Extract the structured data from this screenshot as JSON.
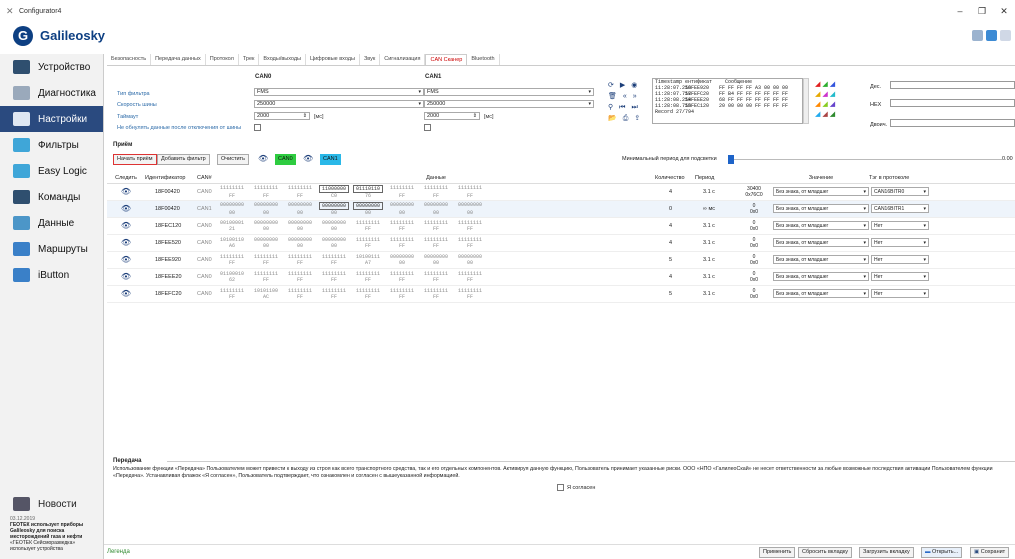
{
  "window": {
    "title": "Configurator4",
    "minimize": "–",
    "maximize": "❐",
    "close": "✕"
  },
  "brand": {
    "logo_letter": "G",
    "logo_text": "Galileosky"
  },
  "sidebar": {
    "items": [
      {
        "label": "Устройство",
        "icon": "device-icon",
        "color": "#2f4f6f"
      },
      {
        "label": "Диагностика",
        "icon": "diagnostics-icon",
        "color": "#9aa9bb"
      },
      {
        "label": "Настройки",
        "icon": "gear-icon",
        "color": "#dfe7f2"
      },
      {
        "label": "Фильтры",
        "icon": "filter-icon",
        "color": "#3fa6d8"
      },
      {
        "label": "Easy Logic",
        "icon": "puzzle-icon",
        "color": "#3fa6d8"
      },
      {
        "label": "Команды",
        "icon": "commands-icon",
        "color": "#2f4f6f"
      },
      {
        "label": "Данные",
        "icon": "data-icon",
        "color": "#4c96c8"
      },
      {
        "label": "Маршруты",
        "icon": "route-icon",
        "color": "#3a80c8"
      },
      {
        "label": "iButton",
        "icon": "ibutton-icon",
        "color": "#3a80c8"
      }
    ],
    "active_index": 2,
    "news_label": "Новости",
    "news_date": "03.12.2019",
    "news_title": "ГЕОТЕК использует приборы Galileosky для поиска месторождений газа и нефти",
    "news_text": "«ГЕОТЕК Сейсморазведка» использует устройства"
  },
  "tabs": [
    "Безопасность",
    "Передача данных",
    "Протокол",
    "Трек",
    "Входы/выходы",
    "Цифровые входы",
    "Звук",
    "Сигнализация",
    "CAN Сканер",
    "Bluetooth"
  ],
  "active_tab": 8,
  "filter": {
    "can0_header": "CAN0",
    "can1_header": "CAN1",
    "type_label": "Тип фильтра",
    "speed_label": "Скорость шины",
    "timeout_label": "Таймаут",
    "reset_label": "Не обнулять данные после отключения от шины",
    "can0_type": "FMS",
    "can1_type": "FMS",
    "can0_speed": "250000",
    "can1_speed": "250000",
    "can0_timeout": "2000",
    "can1_timeout": "2000",
    "timeout_unit": "[мс]"
  },
  "scanner_log": {
    "col_time": "Timestamp",
    "col_id": "ентификат",
    "col_msg": "Сообщение",
    "rows": [
      {
        "t": "11:28:07.256",
        "id": "18FEE920",
        "m": "FF FF FF FF A3 00 00 00"
      },
      {
        "t": "11:28:07.757",
        "id": "18FEFC20",
        "m": "FF B4 FF FF FF FF FF FF"
      },
      {
        "t": "11:28:08.254",
        "id": "18FEEE20",
        "m": "68 FF FF FF FF FF FF FF"
      },
      {
        "t": "11:28:08.755",
        "id": "18FEC120",
        "m": "20 00 00 00 FF FF FF FF"
      }
    ],
    "record": "Record 27/794"
  },
  "number_fields": {
    "dec": "Дес.",
    "hex": "HEX",
    "bin": "Двоич."
  },
  "receive": {
    "title": "Приём",
    "start": "Начать приём",
    "add_filter": "Добавить фильтр",
    "clear": "Очистить",
    "can0_chip": "CAN0",
    "can1_chip": "CAN1",
    "can0_color": "#2ecc40",
    "can1_color": "#2ab8e8",
    "min_period_label": "Минимальный период для подсветки",
    "min_period_value": "0.00"
  },
  "table": {
    "headers": {
      "follow": "Следить",
      "id": "Идентификатор",
      "can": "CAN#",
      "data": "Данные",
      "count": "Количество",
      "period": "Период",
      "value": "Значение",
      "tag": "Тэг в протоколе"
    },
    "rows": [
      {
        "id": "18F00420",
        "can": "CAN0",
        "bits": [
          "11111111",
          "11111111",
          "11111111",
          "11000000",
          "01110110",
          "11111111",
          "11111111",
          "11111111"
        ],
        "hex": [
          "FF",
          "FF",
          "FF",
          "C0",
          "76",
          "FF",
          "FF",
          "FF"
        ],
        "hl": [
          3,
          4
        ],
        "count": "4",
        "period": "3.1 c",
        "v1": "30400",
        "v2": "0x76C0",
        "value": "Без знака, от младшег",
        "tag": "CAN16BITR0"
      },
      {
        "id": "18F00420",
        "can": "CAN1",
        "bits": [
          "00000000",
          "00000000",
          "00000000",
          "00000000",
          "00000000",
          "00000000",
          "00000000",
          "00000000"
        ],
        "hex": [
          "00",
          "00",
          "00",
          "00",
          "00",
          "00",
          "00",
          "00"
        ],
        "hl": [
          3,
          4
        ],
        "count": "0",
        "period": "∞ мс",
        "v1": "0",
        "v2": "0x0",
        "value": "Без знака, от младшег",
        "tag": "CAN16BITR1"
      },
      {
        "id": "18FEC120",
        "can": "CAN0",
        "bits": [
          "00100001",
          "00000000",
          "00000000",
          "00000000",
          "11111111",
          "11111111",
          "11111111",
          "11111111"
        ],
        "hex": [
          "21",
          "00",
          "00",
          "00",
          "FF",
          "FF",
          "FF",
          "FF"
        ],
        "hl": [],
        "count": "4",
        "period": "3.1 c",
        "v1": "0",
        "v2": "0x0",
        "value": "Без знака, от младшег",
        "tag": "Нет"
      },
      {
        "id": "18FEE520",
        "can": "CAN0",
        "bits": [
          "10100110",
          "00000000",
          "00000000",
          "00000000",
          "11111111",
          "11111111",
          "11111111",
          "11111111"
        ],
        "hex": [
          "A6",
          "00",
          "00",
          "00",
          "FF",
          "FF",
          "FF",
          "FF"
        ],
        "hl": [],
        "count": "4",
        "period": "3.1 c",
        "v1": "0",
        "v2": "0x0",
        "value": "Без знака, от младшег",
        "tag": "Нет"
      },
      {
        "id": "18FEE920",
        "can": "CAN0",
        "bits": [
          "11111111",
          "11111111",
          "11111111",
          "11111111",
          "10100111",
          "00000000",
          "00000000",
          "00000000"
        ],
        "hex": [
          "FF",
          "FF",
          "FF",
          "FF",
          "A7",
          "00",
          "00",
          "00"
        ],
        "hl": [],
        "count": "5",
        "period": "3.1 c",
        "v1": "0",
        "v2": "0x0",
        "value": "Без знака, от младшег",
        "tag": "Нет"
      },
      {
        "id": "18FEEE20",
        "can": "CAN0",
        "bits": [
          "01100010",
          "11111111",
          "11111111",
          "11111111",
          "11111111",
          "11111111",
          "11111111",
          "11111111"
        ],
        "hex": [
          "62",
          "FF",
          "FF",
          "FF",
          "FF",
          "FF",
          "FF",
          "FF"
        ],
        "hl": [],
        "count": "4",
        "period": "3.1 c",
        "v1": "0",
        "v2": "0x0",
        "value": "Без знака, от младшег",
        "tag": "Нет"
      },
      {
        "id": "18FEFC20",
        "can": "CAN0",
        "bits": [
          "11111111",
          "10101100",
          "11111111",
          "11111111",
          "11111111",
          "11111111",
          "11111111",
          "11111111"
        ],
        "hex": [
          "FF",
          "AC",
          "FF",
          "FF",
          "FF",
          "FF",
          "FF",
          "FF"
        ],
        "hl": [],
        "count": "5",
        "period": "3.1 c",
        "v1": "0",
        "v2": "0x0",
        "value": "Без знака, от младшег",
        "tag": "Нет"
      }
    ]
  },
  "transmit": {
    "title": "Передача",
    "text": "Использование функции «Передача» Пользователем может привести к выходу из строя как всего транспортного средства, так и его отдельных компонентов. Активируя данную функцию, Пользователь принимает указанные риски. ООО «НПО «ГалилеоСкай» не несет ответственности за любые возможные последствия активации Пользователем функции «Передача». Устанавливая флажок «Я согласен», Пользователь подтверждает, что ознакомлен и согласен с вышеуказанной информацией.",
    "agree": "Я согласен"
  },
  "status": {
    "legend": "Легенда",
    "apply": "Применить",
    "reset_tab": "Сбросить вкладку",
    "load_tab": "Загрузить вкладку",
    "open": "Открыть...",
    "save": "Сохранит"
  }
}
